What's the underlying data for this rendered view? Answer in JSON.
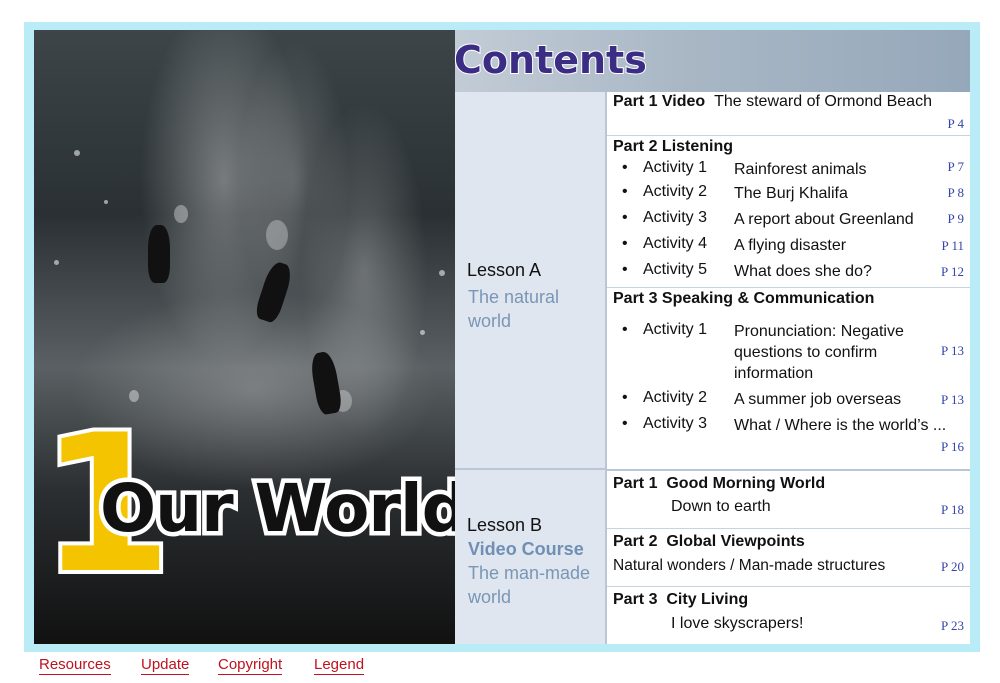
{
  "header": {
    "title": "Contents"
  },
  "unit": {
    "number": "1",
    "title": "Our World"
  },
  "lessons": [
    {
      "name": "Lesson A",
      "subtitle_1": "The natural",
      "subtitle_2": "world"
    },
    {
      "name": "Lesson B",
      "course": "Video Course",
      "subtitle_1": "The man-made",
      "subtitle_2": "world"
    }
  ],
  "lesson_a": {
    "part1": {
      "label": "Part 1 Video",
      "title": "The steward of Ormond Beach",
      "page": "P 4"
    },
    "part2": {
      "label": "Part 2 Listening",
      "activities": [
        {
          "bullet": "•",
          "num": "Activity 1",
          "title": "Rainforest animals",
          "page": "P 7"
        },
        {
          "bullet": "•",
          "num": "Activity 2",
          "title": "The Burj Khalifa",
          "page": "P 8"
        },
        {
          "bullet": "•",
          "num": "Activity 3",
          "title": "A report about Greenland",
          "page": "P 9"
        },
        {
          "bullet": "•",
          "num": "Activity 4",
          "title": "A flying disaster",
          "page": "P 11"
        },
        {
          "bullet": "•",
          "num": "Activity 5",
          "title": "What does she do?",
          "page": "P 12"
        }
      ]
    },
    "part3": {
      "label": "Part 3 Speaking & Communication",
      "activities": [
        {
          "bullet": "•",
          "num": "Activity 1",
          "title": "Pronunciation: Negative questions to confirm information",
          "page": "P 13"
        },
        {
          "bullet": "•",
          "num": "Activity 2",
          "title": "A summer job overseas",
          "page": "P 13"
        },
        {
          "bullet": "•",
          "num": "Activity 3",
          "title": "What / Where is the world’s ...",
          "page": "P 16"
        }
      ]
    }
  },
  "lesson_b": {
    "part1": {
      "label": "Part 1",
      "name": "Good Morning World",
      "title": "Down to earth",
      "page": "P 18"
    },
    "part2": {
      "label": "Part 2",
      "name": "Global Viewpoints",
      "title": "Natural wonders / Man-made structures",
      "page": "P 20"
    },
    "part3": {
      "label": "Part 3",
      "name": "City Living",
      "title": "I love skyscrapers!",
      "page": "P 23"
    }
  },
  "footer": {
    "links": [
      "Resources",
      "Update",
      "Copyright",
      "Legend"
    ]
  },
  "colors": {
    "frame": "#b9ecf6",
    "lesson_bg": "#dfe6ef",
    "title": "#3b2d84",
    "unit_number": "#f5c400",
    "page_ref": "#3344aa",
    "link": "#c0111f"
  }
}
